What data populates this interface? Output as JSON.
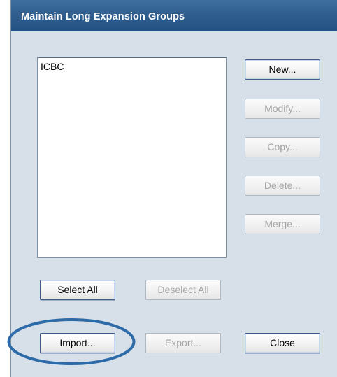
{
  "window": {
    "title": "Maintain Long Expansion Groups"
  },
  "groups_list": {
    "items": [
      "ICBC"
    ]
  },
  "side_buttons": {
    "new_label": "New...",
    "modify_label": "Modify...",
    "copy_label": "Copy...",
    "delete_label": "Delete...",
    "merge_label": "Merge..."
  },
  "selection_buttons": {
    "select_all_label": "Select All",
    "deselect_all_label": "Deselect All"
  },
  "bottom_buttons": {
    "import_label": "Import...",
    "export_label": "Export...",
    "close_label": "Close"
  },
  "button_states": {
    "new": "enabled",
    "modify": "disabled",
    "copy": "disabled",
    "delete": "disabled",
    "merge": "disabled",
    "select_all": "enabled",
    "deselect_all": "disabled",
    "import": "enabled",
    "export": "disabled",
    "close": "enabled"
  },
  "colors": {
    "titlebar": "#2f5e8f",
    "dialog_background": "#d7e0e9",
    "highlight_annotation": "#2d6aa8"
  },
  "annotation": {
    "highlighted_element": "import-button",
    "shape": "ellipse-outline"
  }
}
